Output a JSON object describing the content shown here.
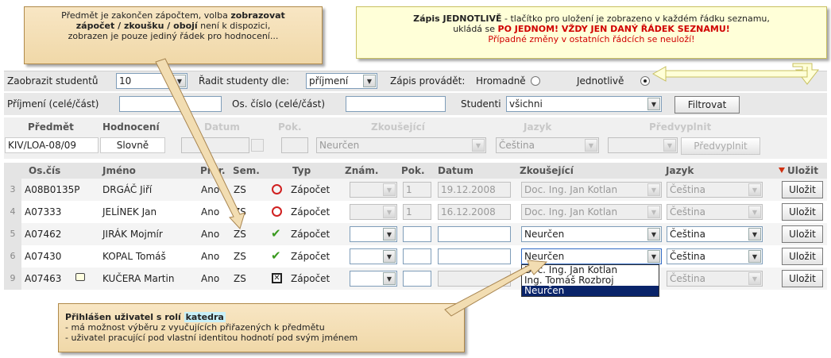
{
  "notes": {
    "left_line1_a": "Předmět je zakončen zápočtem, volba ",
    "left_line1_b": "zobrazovat",
    "left_line2_a": "zápočet / zkoušku / obojí",
    "left_line2_b": " není k dispozici,",
    "left_line3": "zobrazen je pouze jediný řádek pro hodnocení...",
    "right_line1_a": "Zápis JEDNOTLIVĚ",
    "right_line1_b": " - tlačítko pro uložení je zobrazeno v každém řádku seznamu,",
    "right_line2_a": "ukládá se ",
    "right_line2_b": "PO JEDNOM! VŽDY JEN DANÝ ŘÁDEK SEZNAMU!",
    "right_line3": "Případné změny v ostatních řádcích se neuloží!",
    "bottom_title_a": "Přihlášen uživatel s rolí ",
    "bottom_title_b": "katedra",
    "bottom_line2": "- má možnost výběru z vyučujících přiřazených k předmětu",
    "bottom_line3": "- uživatel pracující pod vlastní identitou hodnotí pod svým jménem"
  },
  "filters": {
    "show_students_label": "Zaobrazit studentů",
    "show_students_value": "10",
    "sort_label": "Řadit studenty dle:",
    "sort_value": "příjmení",
    "mode_label": "Zápis provádět:",
    "mode_bulk": "Hromadně",
    "mode_single": "Jednotlivě",
    "surname_label": "Příjmení (celé/část)",
    "surname_value": "",
    "pers_label": "Os. číslo (celé/část)",
    "pers_value": "",
    "students_label": "Studenti",
    "students_value": "všichni",
    "filter_button": "Filtrovat"
  },
  "subject": {
    "headers": [
      "Předmět",
      "Hodnocení",
      "Datum",
      "Pok.",
      "Zkoušející",
      "Jazyk",
      "Předvyplnit"
    ],
    "code": "KIV/LOA-08/09",
    "grading": "Slovně",
    "examiner": "Neurčen",
    "language": "Čeština",
    "prefill_button": "Předvyplnit"
  },
  "table": {
    "headers": [
      "Os.čís",
      "Jméno",
      "Prer.",
      "Sem.",
      "Typ",
      "Znám.",
      "Pok.",
      "Datum",
      "Zkoušející",
      "Jazyk",
      "Uložit"
    ],
    "rows": [
      {
        "num": "3",
        "id": "A08B0135P",
        "name": "DRGÁČ Jiří",
        "prer": "Ano",
        "sem": "ZS",
        "type": "Zápočet",
        "pok": "1",
        "date": "19.12.2008",
        "examiner": "Doc. Ing. Jan Kotlan",
        "lang": "Čeština",
        "save": "Uložit"
      },
      {
        "num": "4",
        "id": "A07333",
        "name": "JELÍNEK Jan",
        "prer": "Ano",
        "sem": "ZS",
        "type": "Zápočet",
        "pok": "1",
        "date": "16.12.2008",
        "examiner": "Doc. Ing. Jan Kotlan",
        "lang": "Čeština",
        "save": "Uložit"
      },
      {
        "num": "5",
        "id": "A07462",
        "name": "JIRÁK Mojmír",
        "prer": "Ano",
        "sem": "ZS",
        "type": "Zápočet",
        "pok": "",
        "date": "",
        "examiner": "Neurčen",
        "lang": "Čeština",
        "save": "Uložit"
      },
      {
        "num": "6",
        "id": "A07430",
        "name": "KOPAL Tomáš",
        "prer": "Ano",
        "sem": "ZS",
        "type": "Zápočet",
        "pok": "",
        "date": "",
        "examiner": "Neurčen",
        "lang": "Čeština",
        "save": "Uložit"
      },
      {
        "num": "9",
        "id": "A07463",
        "name": "KUČERA Martin",
        "prer": "Ano",
        "sem": "ZS",
        "type": "Zápočet",
        "pok": "",
        "date": "",
        "examiner": "",
        "lang": "Čeština",
        "save": "Uložit"
      }
    ]
  },
  "dropdown": {
    "options": [
      "Doc. Ing. Jan Kotlan",
      "Ing. Tomáš Rozbroj",
      "Neurčen"
    ],
    "selected_index": 2
  }
}
